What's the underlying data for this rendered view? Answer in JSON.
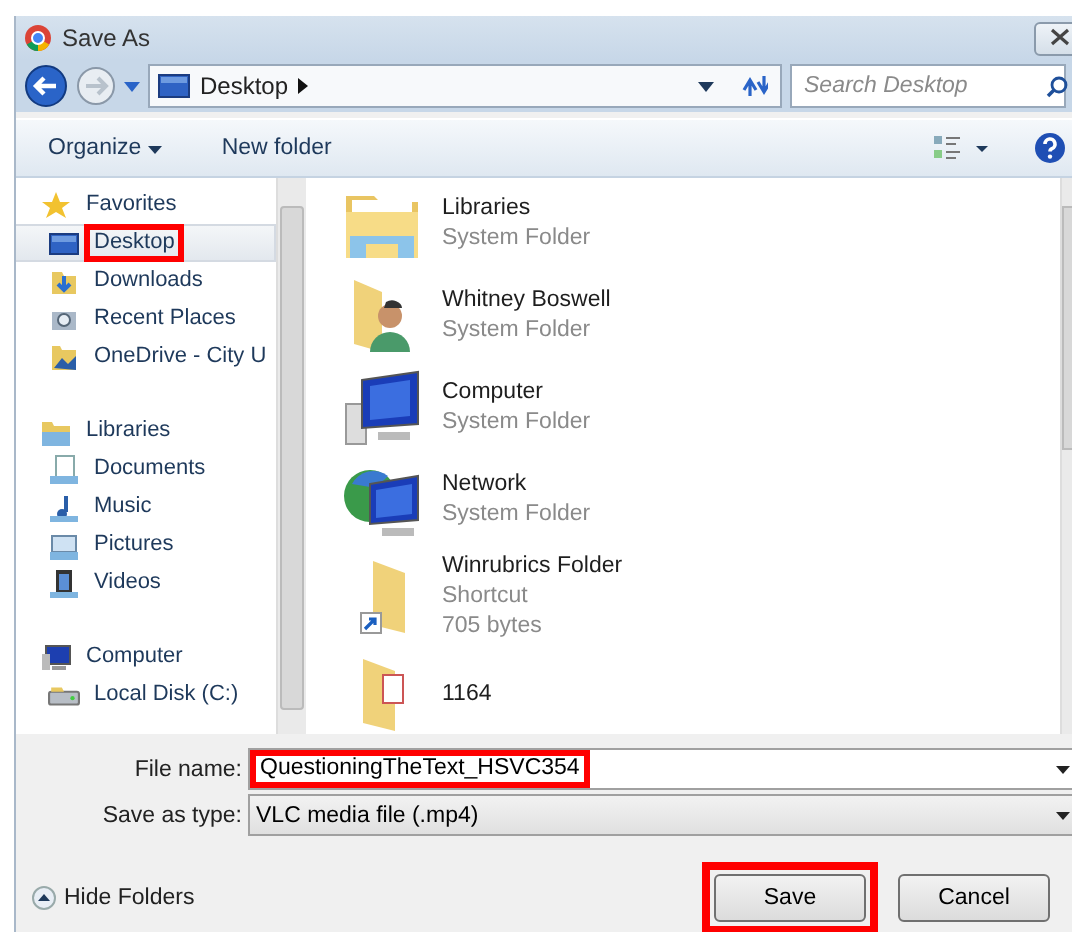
{
  "window": {
    "title": "Save As"
  },
  "navigation": {
    "address": "Desktop",
    "search_placeholder": "Search Desktop"
  },
  "toolbar": {
    "organize": "Organize",
    "new_folder": "New folder"
  },
  "sidebar": {
    "groups": [
      {
        "label": "Favorites",
        "kind": "favorites",
        "children": [
          {
            "label": "Desktop",
            "kind": "desktop",
            "selected": true,
            "highlighted": true
          },
          {
            "label": "Downloads",
            "kind": "downloads",
            "selected": false,
            "highlighted": false
          },
          {
            "label": "Recent Places",
            "kind": "recent",
            "selected": false,
            "highlighted": false
          },
          {
            "label": "OneDrive - City U",
            "kind": "folder",
            "selected": false,
            "highlighted": false
          }
        ]
      },
      {
        "label": "Libraries",
        "kind": "libraries",
        "children": [
          {
            "label": "Documents",
            "kind": "documents",
            "selected": false,
            "highlighted": false
          },
          {
            "label": "Music",
            "kind": "music",
            "selected": false,
            "highlighted": false
          },
          {
            "label": "Pictures",
            "kind": "pictures",
            "selected": false,
            "highlighted": false
          },
          {
            "label": "Videos",
            "kind": "videos",
            "selected": false,
            "highlighted": false
          }
        ]
      },
      {
        "label": "Computer",
        "kind": "computer",
        "children": [
          {
            "label": "Local Disk (C:)",
            "kind": "disk",
            "selected": false,
            "highlighted": false
          }
        ]
      }
    ]
  },
  "files": [
    {
      "name": "Libraries",
      "kind": "libraries",
      "details": [
        "System Folder"
      ]
    },
    {
      "name": "Whitney Boswell",
      "kind": "user",
      "details": [
        "System Folder"
      ]
    },
    {
      "name": "Computer",
      "kind": "computer",
      "details": [
        "System Folder"
      ]
    },
    {
      "name": "Network",
      "kind": "network",
      "details": [
        "System Folder"
      ]
    },
    {
      "name": "Winrubrics Folder",
      "kind": "shortcut",
      "details": [
        "Shortcut",
        "705 bytes"
      ]
    },
    {
      "name": "1164",
      "kind": "folder"
    }
  ],
  "form": {
    "file_name_label": "File name:",
    "file_name": "QuestioningTheText_HSVC354",
    "file_name_highlighted": true,
    "type_label": "Save as type:",
    "type": "VLC media file (.mp4)"
  },
  "footer": {
    "hide_folders": "Hide Folders",
    "buttons": [
      {
        "label": "Save",
        "highlighted": true
      },
      {
        "label": "Cancel",
        "highlighted": false
      }
    ]
  }
}
